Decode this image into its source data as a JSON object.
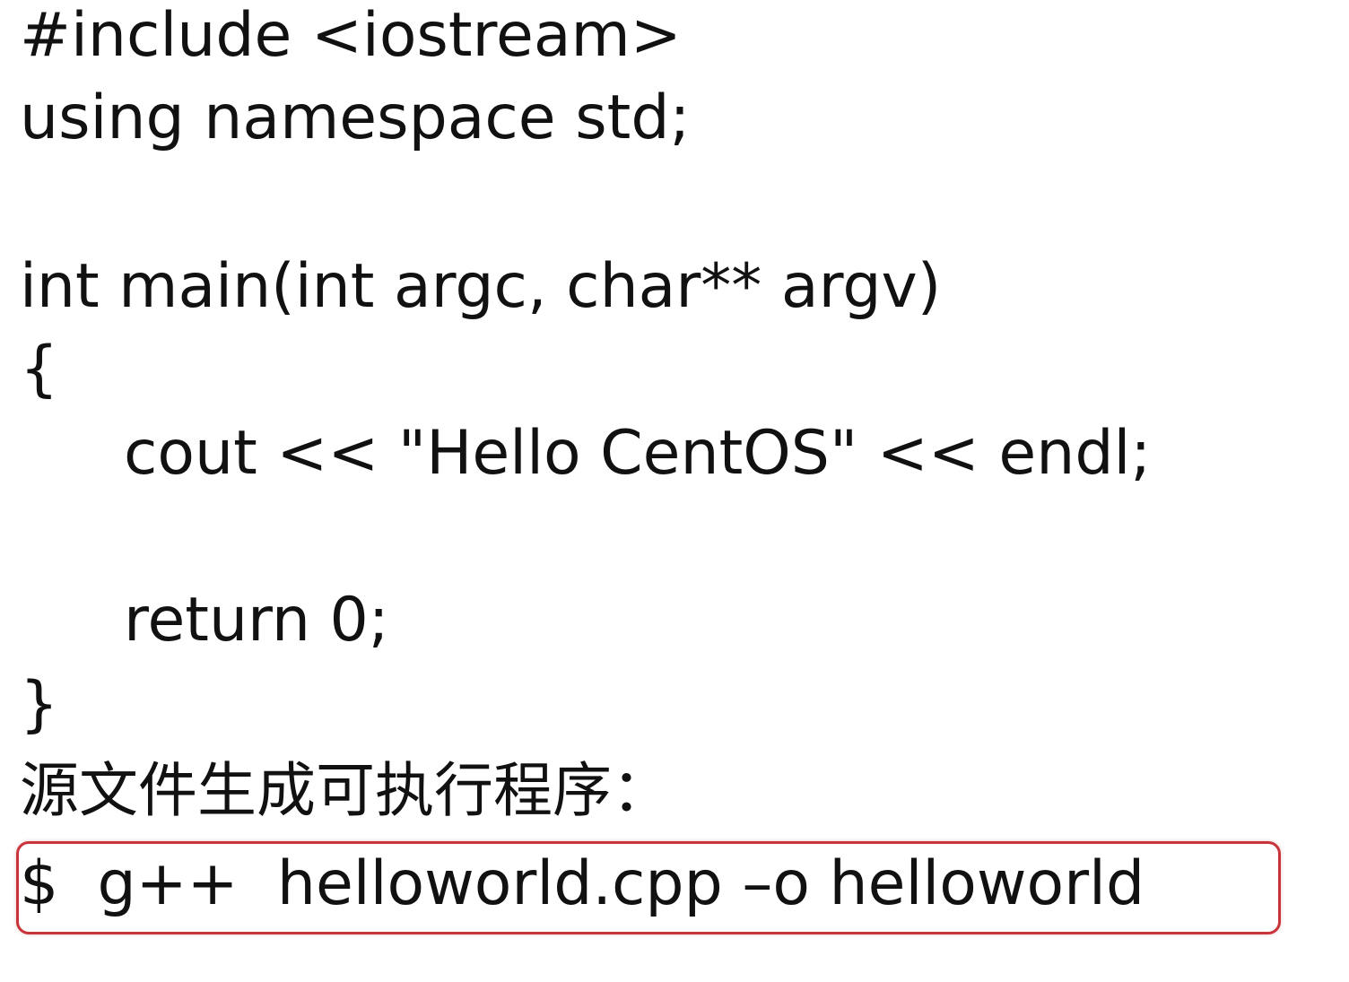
{
  "code": {
    "line1": "#include <iostream>",
    "line2": "using namespace std;",
    "line3": "int main(int argc, char** argv)",
    "line4": "{",
    "line5": "cout << \"Hello CentOS\" << endl;",
    "line6": "return 0;",
    "line7": "}"
  },
  "caption": "源文件生成可执行程序：",
  "command": "$  g++  helloworld.cpp –o helloworld",
  "colors": {
    "highlight_border": "#c9343a",
    "text": "#111111",
    "background": "#ffffff"
  }
}
